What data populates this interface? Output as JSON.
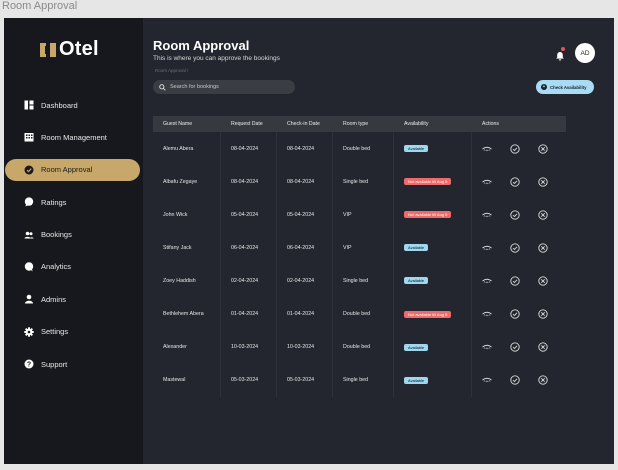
{
  "frame_label": "Room Approval",
  "brand": {
    "name": "Otel",
    "accent": "#c8a86a"
  },
  "sidebar": {
    "items": [
      {
        "label": "Dashboard",
        "icon": "grid-icon",
        "active": false
      },
      {
        "label": "Room Management",
        "icon": "building-icon",
        "active": false
      },
      {
        "label": "Room Approval",
        "icon": "check-circle-icon",
        "active": true
      },
      {
        "label": "Ratings",
        "icon": "chat-bubble-icon",
        "active": false
      },
      {
        "label": "Bookings",
        "icon": "users-icon",
        "active": false
      },
      {
        "label": "Analytics",
        "icon": "comment-icon",
        "active": false
      },
      {
        "label": "Admins",
        "icon": "person-icon",
        "active": false
      },
      {
        "label": "Settings",
        "icon": "gear-icon",
        "active": false
      },
      {
        "label": "Support",
        "icon": "help-icon",
        "active": false
      }
    ]
  },
  "header": {
    "title": "Room Approval",
    "subtitle": "This is where you can approve the bookings",
    "breadcrumb": "Room Approval  /",
    "search_placeholder": "Search for bookings",
    "avatar_initials": "AD",
    "check_button": "Check Availability"
  },
  "table": {
    "headers": [
      "Guest Name",
      "Request Date",
      "Check-in Date",
      "Room type",
      "Availability",
      "Actions"
    ],
    "rows": [
      {
        "guest": "Alemu Abera",
        "request": "08-04-2024",
        "checkin": "08-04-2024",
        "room": "Double bed",
        "availability": "Available",
        "status": "available"
      },
      {
        "guest": "Albafu Zegaye",
        "request": "08-04-2024",
        "checkin": "08-04-2024",
        "room": "Single bed",
        "availability": "Not available till Aug 5",
        "status": "not"
      },
      {
        "guest": "John Wick",
        "request": "05-04-2024",
        "checkin": "05-04-2024",
        "room": "VIP",
        "availability": "Not available till Aug 5",
        "status": "not"
      },
      {
        "guest": "Stifany Jack",
        "request": "06-04-2024",
        "checkin": "06-04-2024",
        "room": "VIP",
        "availability": "Available",
        "status": "available"
      },
      {
        "guest": "Zoey Haddish",
        "request": "02-04-2024",
        "checkin": "02-04-2024",
        "room": "Single bed",
        "availability": "Available",
        "status": "available"
      },
      {
        "guest": "Bethlehem Abera",
        "request": "01-04-2024",
        "checkin": "01-04-2024",
        "room": "Double bed",
        "availability": "Not available till Aug 5",
        "status": "not"
      },
      {
        "guest": "Alexander",
        "request": "10-03-2024",
        "checkin": "10-03-2024",
        "room": "Double bed",
        "availability": "Available",
        "status": "available"
      },
      {
        "guest": "Mastewal",
        "request": "05-03-2024",
        "checkin": "05-03-2024",
        "room": "Single bed",
        "availability": "Available",
        "status": "available"
      }
    ]
  },
  "colors": {
    "sidebar_bg": "#16181d",
    "main_bg": "#23262e",
    "available": "#9ed8f0",
    "not_available": "#ef6a6a",
    "button": "#a9dcf4"
  }
}
